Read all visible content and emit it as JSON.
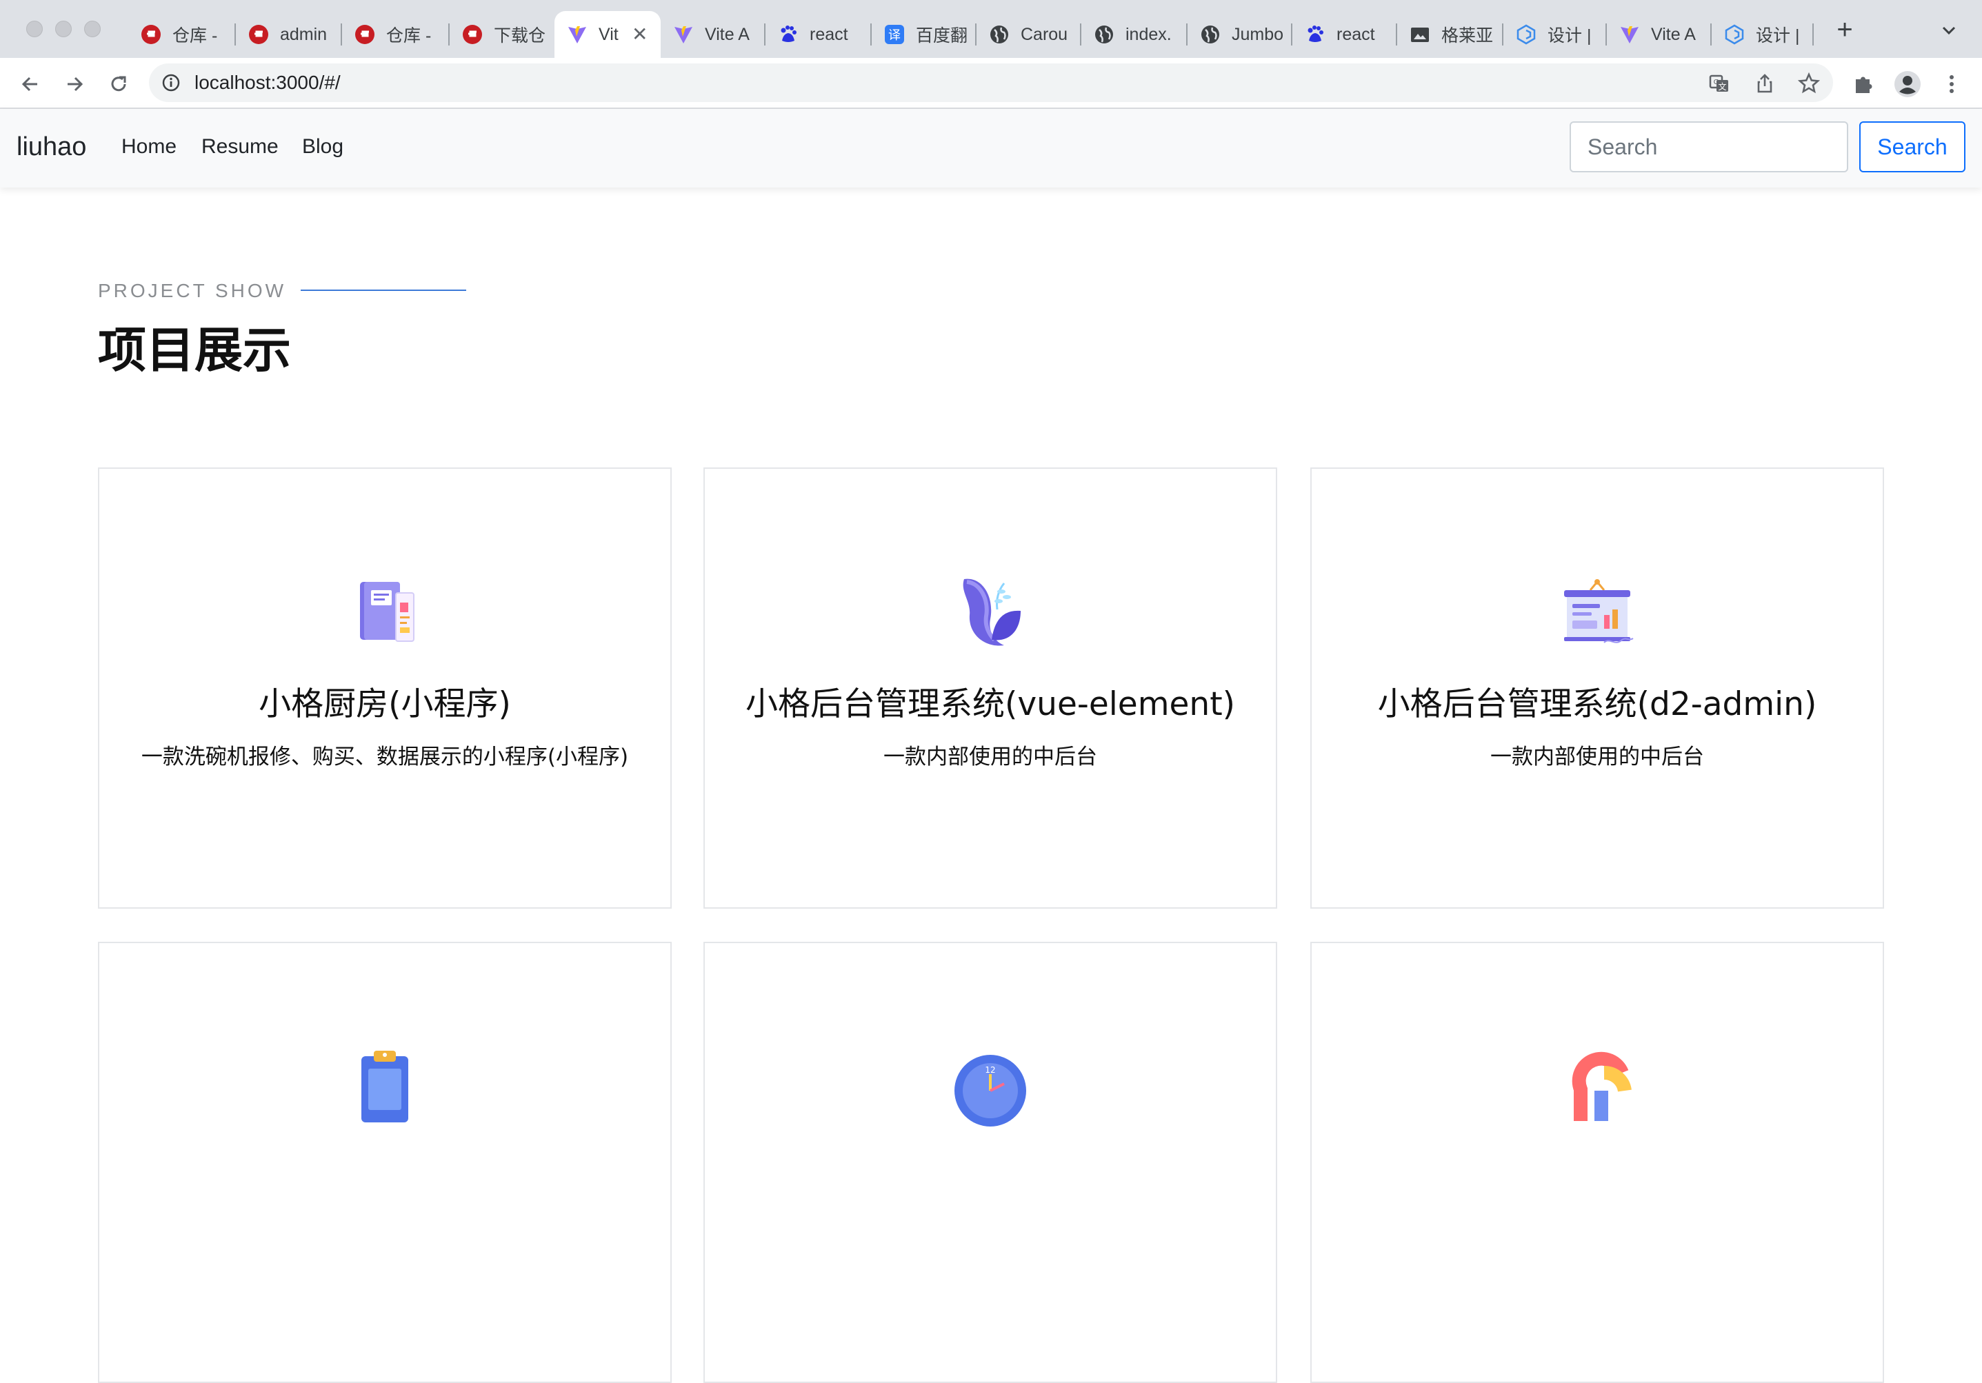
{
  "browser": {
    "tabs": [
      {
        "title": "仓库 -",
        "icon": "gitee-icon"
      },
      {
        "title": "admin",
        "icon": "gitee-icon"
      },
      {
        "title": "仓库 -",
        "icon": "gitee-icon"
      },
      {
        "title": "下载仓",
        "icon": "gitee-icon"
      },
      {
        "title": "Vit",
        "icon": "vite-icon"
      },
      {
        "title": "Vite A",
        "icon": "vite-icon"
      },
      {
        "title": "react",
        "icon": "baidu-paw-icon"
      },
      {
        "title": "百度翻",
        "icon": "baidu-translate-icon"
      },
      {
        "title": "Carou",
        "icon": "globe-icon"
      },
      {
        "title": "index.",
        "icon": "globe-icon"
      },
      {
        "title": "Jumbo",
        "icon": "globe-icon"
      },
      {
        "title": "react",
        "icon": "baidu-paw-icon"
      },
      {
        "title": "格莱亚",
        "icon": "image-folder-icon"
      },
      {
        "title": "设计 |",
        "icon": "design-cube-icon"
      },
      {
        "title": "Vite A",
        "icon": "vite-icon"
      },
      {
        "title": "设计 |",
        "icon": "design-cube-icon"
      }
    ],
    "active_tab": 4,
    "url": "localhost:3000/#/"
  },
  "navbar": {
    "brand": "liuhao",
    "links": [
      "Home",
      "Resume",
      "Blog"
    ],
    "search_placeholder": "Search",
    "search_button": "Search"
  },
  "section": {
    "eyebrow": "PROJECT SHOW",
    "title": "项目展示"
  },
  "projects": [
    {
      "title": "小格厨房(小程序)",
      "desc": "一款洗碗机报修、购买、数据展示的小程序(小程序)",
      "icon": "notebook-icon"
    },
    {
      "title": "小格后台管理系统(vue-element)",
      "desc": "一款内部使用的中后台",
      "icon": "plant-leaf-icon"
    },
    {
      "title": "小格后台管理系统(d2-admin)",
      "desc": "一款内部使用的中后台",
      "icon": "presentation-board-icon"
    },
    {
      "icon": "clipboard-icon"
    },
    {
      "icon": "clock-icon"
    },
    {
      "icon": "magnet-icon"
    }
  ],
  "colors": {
    "accent": "#0d6efd",
    "eyebrow_line": "#3d7ad8",
    "icon_purple": "#7b72e9",
    "icon_blue": "#4d73e8"
  }
}
